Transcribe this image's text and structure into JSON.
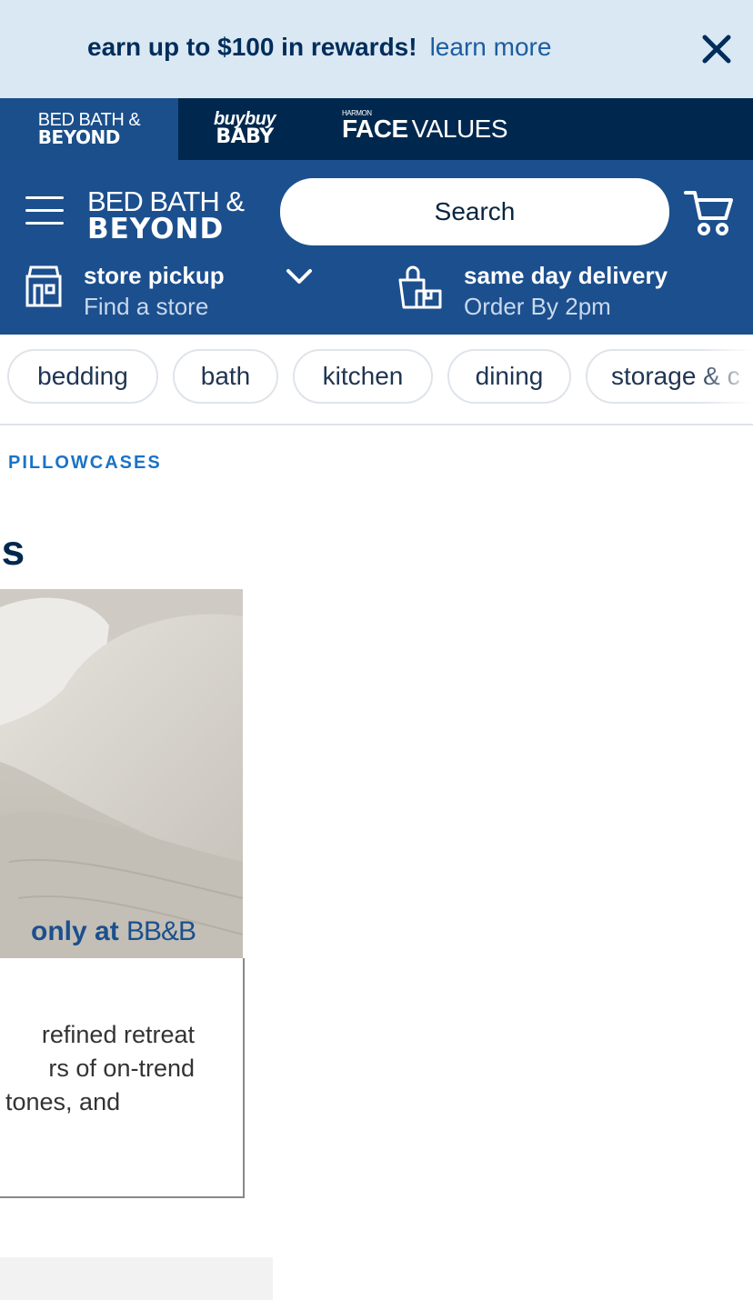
{
  "promo": {
    "text_bold": "earn up to $100 in rewards!",
    "link": "learn more",
    "close_icon": "close-icon"
  },
  "brands": {
    "bbb_line1": "BED BATH &",
    "bbb_line2": "BEYOND",
    "baby_line1": "buybuy",
    "baby_line2": "BABY",
    "fv_small": "HARMON",
    "fv_bold": "FACE",
    "fv_regular": "VALUES"
  },
  "header": {
    "menu_icon": "hamburger-icon",
    "logo_line1": "BED BATH &",
    "logo_line2": "BEYOND",
    "search_placeholder": "Search",
    "cart_icon": "cart-icon",
    "pickup_title": "store pickup",
    "pickup_sub": "Find a store",
    "delivery_title": "same day delivery",
    "delivery_sub": "Order By 2pm"
  },
  "categories": [
    "bedding",
    "bath",
    "kitchen",
    "dining",
    "storage & c"
  ],
  "breadcrumb": "PILLOWCASES",
  "page_title": "es",
  "hero": {
    "badge_bold": "only at",
    "badge_brand": "BB&B",
    "copy_lines": [
      "refined retreat",
      "rs of on-trend",
      "tones, and"
    ]
  },
  "colors": {
    "promo_bg": "#dae8f3",
    "brandbar_bg": "#00284e",
    "header_bg": "#1c4f8d",
    "link_blue": "#1a73c7"
  }
}
